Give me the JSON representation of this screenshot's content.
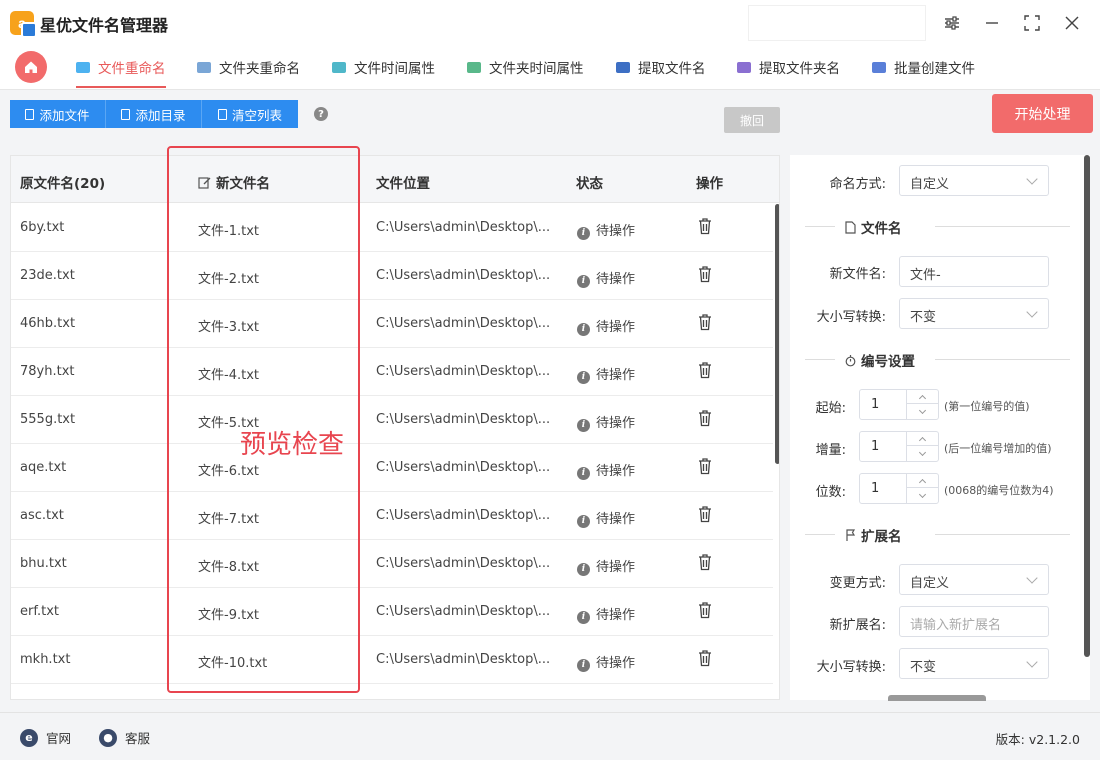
{
  "app": {
    "title": "星优文件名管理器"
  },
  "nav": {
    "tabs": [
      {
        "label": "文件重命名",
        "active": true,
        "icon_color": "#4db2f0"
      },
      {
        "label": "文件夹重命名",
        "active": false,
        "icon_color": "#7aa6d6"
      },
      {
        "label": "文件时间属性",
        "active": false,
        "icon_color": "#4fb7c9"
      },
      {
        "label": "文件夹时间属性",
        "active": false,
        "icon_color": "#59b88a"
      },
      {
        "label": "提取文件名",
        "active": false,
        "icon_color": "#3d6fc4"
      },
      {
        "label": "提取文件夹名",
        "active": false,
        "icon_color": "#8a6fd1"
      },
      {
        "label": "批量创建文件",
        "active": false,
        "icon_color": "#5a7fd8"
      }
    ]
  },
  "toolbar": {
    "add_file": "添加文件",
    "add_dir": "添加目录",
    "clear_list": "清空列表",
    "help": "?",
    "undo": "撤回",
    "start": "开始处理"
  },
  "table": {
    "headers": {
      "original": "原文件名(20)",
      "new": "新文件名",
      "location": "文件位置",
      "status": "状态",
      "action": "操作"
    },
    "rows": [
      {
        "original": "6by.txt",
        "new": "文件-1.txt",
        "location": "C:\\Users\\admin\\Desktop\\...",
        "status": "待操作"
      },
      {
        "original": "23de.txt",
        "new": "文件-2.txt",
        "location": "C:\\Users\\admin\\Desktop\\...",
        "status": "待操作"
      },
      {
        "original": "46hb.txt",
        "new": "文件-3.txt",
        "location": "C:\\Users\\admin\\Desktop\\...",
        "status": "待操作"
      },
      {
        "original": "78yh.txt",
        "new": "文件-4.txt",
        "location": "C:\\Users\\admin\\Desktop\\...",
        "status": "待操作"
      },
      {
        "original": "555g.txt",
        "new": "文件-5.txt",
        "location": "C:\\Users\\admin\\Desktop\\...",
        "status": "待操作"
      },
      {
        "original": "aqe.txt",
        "new": "文件-6.txt",
        "location": "C:\\Users\\admin\\Desktop\\...",
        "status": "待操作"
      },
      {
        "original": "asc.txt",
        "new": "文件-7.txt",
        "location": "C:\\Users\\admin\\Desktop\\...",
        "status": "待操作"
      },
      {
        "original": "bhu.txt",
        "new": "文件-8.txt",
        "location": "C:\\Users\\admin\\Desktop\\...",
        "status": "待操作"
      },
      {
        "original": "erf.txt",
        "new": "文件-9.txt",
        "location": "C:\\Users\\admin\\Desktop\\...",
        "status": "待操作"
      },
      {
        "original": "mkh.txt",
        "new": "文件-10.txt",
        "location": "C:\\Users\\admin\\Desktop\\...",
        "status": "待操作"
      }
    ]
  },
  "annotation": {
    "text": "预览检查",
    "color": "#e8454f"
  },
  "settings": {
    "naming_mode_label": "命名方式:",
    "naming_mode_value": "自定义",
    "filename_section": "文件名",
    "new_name_label": "新文件名:",
    "new_name_value": "文件-",
    "case_label": "大小写转换:",
    "case_value": "不变",
    "numbering_section": "编号设置",
    "start_label": "起始:",
    "start_value": "1",
    "start_hint": "(第一位编号的值)",
    "step_label": "增量:",
    "step_value": "1",
    "step_hint": "(后一位编号增加的值)",
    "digits_label": "位数:",
    "digits_value": "1",
    "digits_hint": "(0068的编号位数为4)",
    "ext_section": "扩展名",
    "ext_mode_label": "变更方式:",
    "ext_mode_value": "自定义",
    "new_ext_label": "新扩展名:",
    "new_ext_placeholder": "请输入新扩展名",
    "ext_case_label": "大小写转换:",
    "ext_case_value": "不变"
  },
  "footer": {
    "website": "官网",
    "support": "客服",
    "version": "版本: v2.1.2.0"
  },
  "colors": {
    "accent": "#f26b6b",
    "primary": "#2d8cf0"
  }
}
